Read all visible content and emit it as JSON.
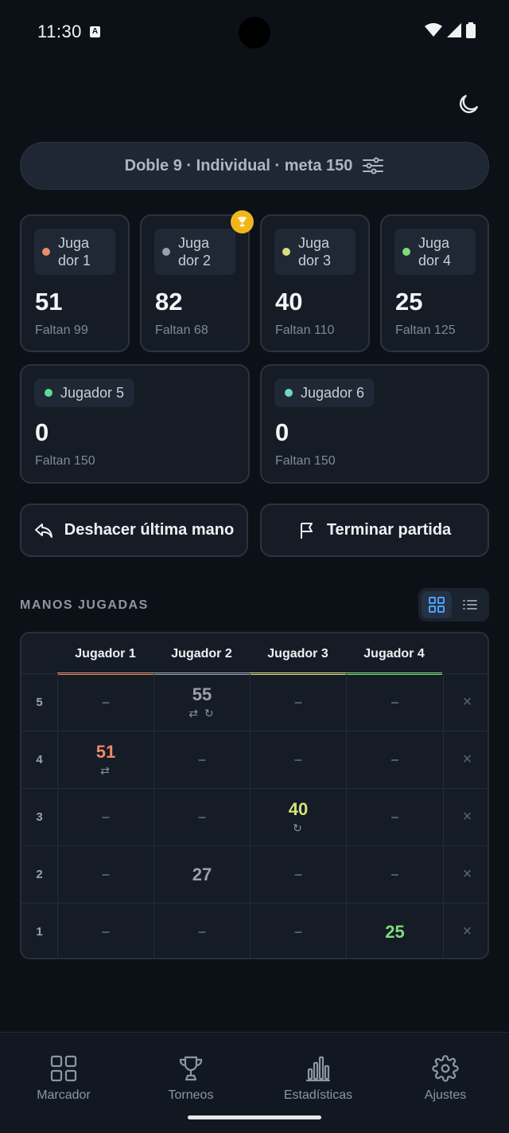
{
  "status_bar": {
    "time": "11:30",
    "notif_badge": "A"
  },
  "config": {
    "label": "Doble 9 · Individual · meta 150"
  },
  "colors": {
    "p1": "#e98a6c",
    "p2": "#9aa1ad",
    "p3": "#d6e07a",
    "p4": "#7edc7a",
    "p5": "#5fdc8f",
    "p6": "#6fd6c8",
    "accent": "#4ea1ff"
  },
  "players": [
    {
      "name": "Juga dor 1",
      "score": "51",
      "remaining": "Faltan 99"
    },
    {
      "name": "Juga dor 2",
      "score": "82",
      "remaining": "Faltan 68",
      "leader": true
    },
    {
      "name": "Juga dor 3",
      "score": "40",
      "remaining": "Faltan 110"
    },
    {
      "name": "Juga dor 4",
      "score": "25",
      "remaining": "Faltan 125"
    },
    {
      "name": "Jugador 5",
      "score": "0",
      "remaining": "Faltan 150"
    },
    {
      "name": "Jugador 6",
      "score": "0",
      "remaining": "Faltan 150"
    }
  ],
  "actions": {
    "undo": "Deshacer última mano",
    "finish": "Terminar partida"
  },
  "hands": {
    "title": "MANOS JUGADAS",
    "columns": [
      "Jugador 1",
      "Jugador 2",
      "Jugador 3",
      "Jugador 4"
    ],
    "empty": "–",
    "rows": [
      {
        "num": "5",
        "cells": [
          "–",
          "55",
          "–",
          "–"
        ],
        "marks": [
          "",
          "⇄ ↻",
          "",
          ""
        ]
      },
      {
        "num": "4",
        "cells": [
          "51",
          "–",
          "–",
          "–"
        ],
        "marks": [
          "⇄",
          "",
          "",
          ""
        ]
      },
      {
        "num": "3",
        "cells": [
          "–",
          "–",
          "40",
          "–"
        ],
        "marks": [
          "",
          "",
          "↻",
          ""
        ]
      },
      {
        "num": "2",
        "cells": [
          "–",
          "27",
          "–",
          "–"
        ],
        "marks": [
          "",
          "",
          "",
          ""
        ]
      },
      {
        "num": "1",
        "cells": [
          "–",
          "–",
          "–",
          "25"
        ],
        "marks": [
          "",
          "",
          "",
          ""
        ]
      }
    ],
    "delete_glyph": "×"
  },
  "nav": [
    {
      "label": "Marcador",
      "icon": "grid-icon"
    },
    {
      "label": "Torneos",
      "icon": "trophy-icon"
    },
    {
      "label": "Estadísticas",
      "icon": "bar-chart-icon"
    },
    {
      "label": "Ajustes",
      "icon": "gear-icon"
    }
  ]
}
